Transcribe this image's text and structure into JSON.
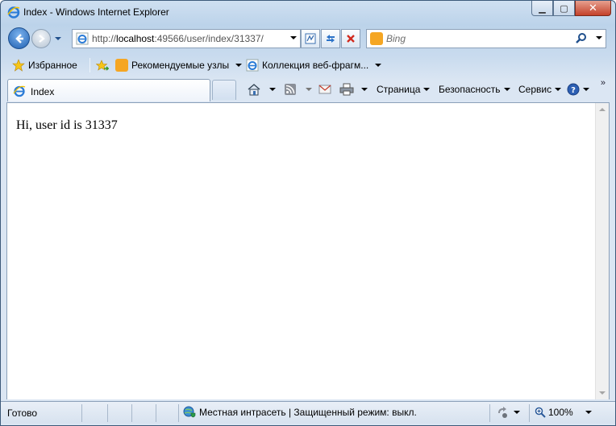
{
  "window": {
    "title": "Index - Windows Internet Explorer",
    "caption_buttons": {
      "minimize": "▁",
      "maximize": "▢",
      "close": "✕"
    }
  },
  "nav": {
    "address": {
      "prefix": "http://",
      "host": "localhost",
      "path": ":49566/user/index/31337/"
    },
    "search": {
      "placeholder": "Bing"
    }
  },
  "favorites": {
    "favorites_label": "Избранное",
    "suggested_sites": "Рекомендуемые узлы",
    "web_slice_gallery": "Коллекция веб-фрагм..."
  },
  "tabs": [
    {
      "label": "Index"
    }
  ],
  "command_bar": {
    "page": "Страница",
    "safety": "Безопасность",
    "tools": "Сервис",
    "overflow": "»"
  },
  "content": {
    "text": "Hi, user id is 31337"
  },
  "status": {
    "state": "Готово",
    "zone": "Местная интрасеть | Защищенный режим: выкл.",
    "zoom": "100%"
  },
  "icons": [
    "ie-logo-icon",
    "back-arrow-icon",
    "forward-arrow-icon",
    "compatibility-view-icon",
    "refresh-icon",
    "stop-icon",
    "bing-icon",
    "search-icon",
    "favorites-star-icon",
    "add-to-favorites-icon",
    "home-icon",
    "rss-feed-icon",
    "mail-icon",
    "print-icon",
    "help-icon",
    "globe-shield-icon",
    "page-status-icon",
    "zoom-icon"
  ],
  "colors": {
    "chrome": "#c9dbee",
    "close_button": "#c4412a",
    "back_button": "#1f5fb0",
    "bing": "#f5a623"
  }
}
